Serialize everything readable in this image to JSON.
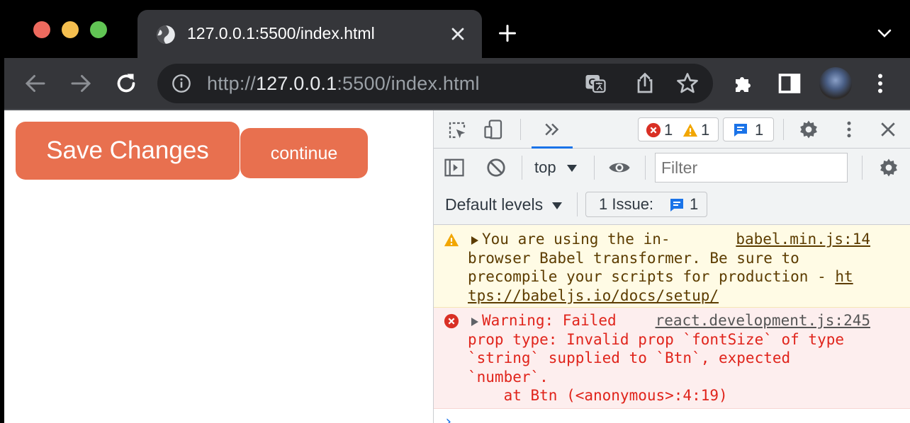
{
  "browser": {
    "tab_title": "127.0.0.1:5500/index.html",
    "url_scheme": "http://",
    "url_host": "127.0.0.1",
    "url_rest": ":5500/index.html",
    "traffic_lights": {
      "close": "#ed6a5e",
      "minimize": "#f5bf4f",
      "zoom": "#61c554"
    }
  },
  "page": {
    "save_button": "Save Changes",
    "continue_button": "continue",
    "button_color": "#e8704f"
  },
  "devtools": {
    "error_count": "1",
    "warning_count": "1",
    "info_count": "1",
    "context": "top",
    "filter_placeholder": "Filter",
    "levels_label": "Default levels",
    "issues_label": "1 Issue:",
    "issues_count": "1",
    "messages": [
      {
        "level": "warning",
        "source": "babel.min.js:14",
        "lines": [
          "You are using the in-",
          "browser Babel transformer. Be sure to",
          "precompile your scripts for production - ",
          "tps://babeljs.io/docs/setup/"
        ],
        "link_start": "ht"
      },
      {
        "level": "error",
        "source": "react.development.js:245",
        "lines": [
          "Warning: Failed",
          "prop type: Invalid prop `fontSize` of type",
          "`string` supplied to `Btn`, expected",
          "`number`.",
          "    at Btn (<anonymous>:4:19)"
        ]
      }
    ],
    "prompt": "›"
  }
}
